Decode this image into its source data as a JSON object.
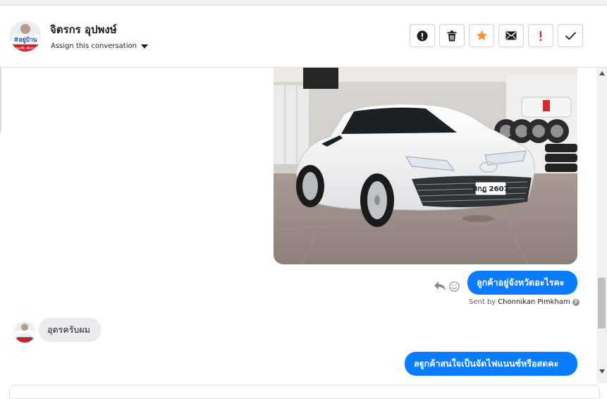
{
  "conversation": {
    "contact_name": "จิตรกร อุปพงษ์",
    "assign_label": "Assign this conversation",
    "avatar_text": "#อยู่บ้าน",
    "avatar_subtext": "หยุดเชื้อ เพื่อชาติ",
    "actions": [
      {
        "icon": "exclamation-circle-icon"
      },
      {
        "icon": "trash-icon"
      },
      {
        "icon": "star-icon",
        "color": "#f7923b"
      },
      {
        "icon": "envelope-icon"
      },
      {
        "icon": "exclamation-icon",
        "color": "#e02020"
      },
      {
        "icon": "check-icon"
      }
    ]
  },
  "messages": [
    {
      "direction": "outgoing",
      "type": "image",
      "plate": "8กฎ 2607"
    },
    {
      "direction": "outgoing",
      "type": "text",
      "text": "ลูกค้าอยู่จังหวัดอะไรคะ",
      "sent_by_prefix": "Sent by",
      "sent_by_name": "Chonnikan Pimkham"
    },
    {
      "direction": "incoming",
      "type": "text",
      "text": "อุดรครับผม"
    },
    {
      "direction": "outgoing",
      "type": "text",
      "text": "ลฐูกค้าสนใจเป็นจัดไฟแนนซ์หรือสดคะ"
    }
  ],
  "colors": {
    "outgoing_bubble": "#0a7cff",
    "incoming_bubble": "#e9ebee",
    "star": "#f7923b",
    "alert": "#e02020"
  }
}
